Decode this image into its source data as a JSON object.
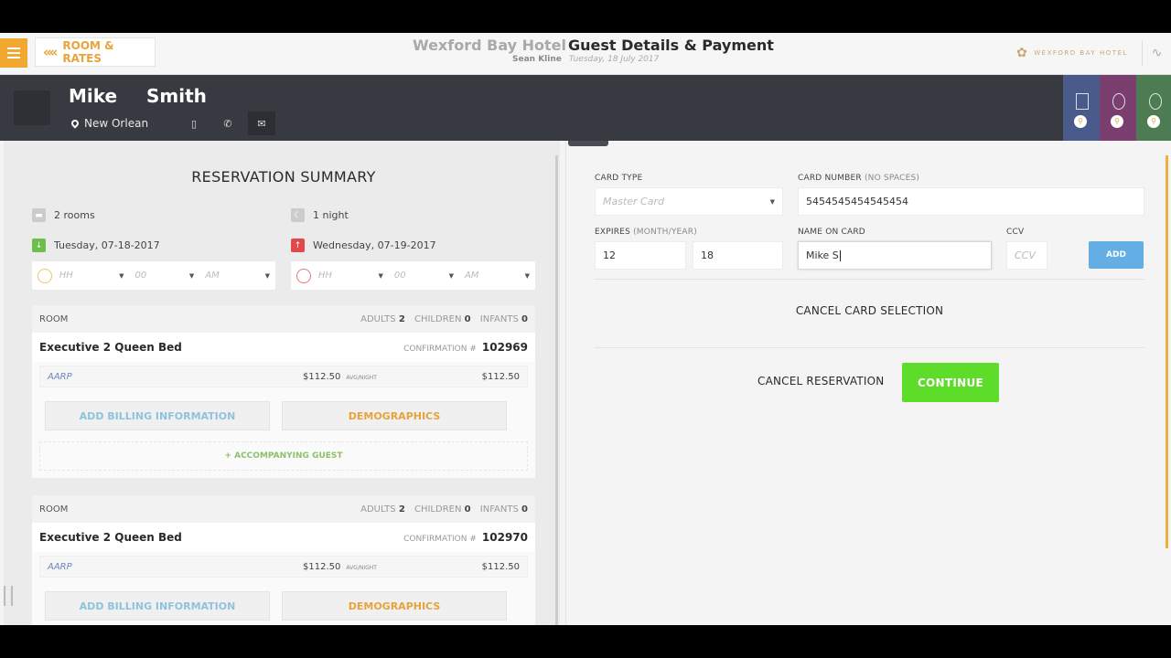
{
  "header": {
    "back_label": "ROOM & RATES",
    "hotel_name": "Wexford Bay Hotel",
    "page_title": "Guest Details & Payment",
    "agent_name": "Sean Kline",
    "date": "Tuesday, 18 July 2017",
    "brand_logo_text": "WEXFORD BAY HOTEL"
  },
  "guest": {
    "first_name": "Mike",
    "last_name": "Smith",
    "location": "New Orlean",
    "side_tab_colors": [
      "#4a5a8a",
      "#7a3f6f",
      "#4e7c52",
      "#3a7a58"
    ]
  },
  "summary": {
    "title": "RESERVATION SUMMARY",
    "rooms": "2 rooms",
    "nights": "1 night",
    "checkin": "Tuesday, 07-18-2017",
    "checkout": "Wednesday, 07-19-2017",
    "time_placeholders": {
      "hour": "HH",
      "minute": "00",
      "ampm": "AM"
    }
  },
  "room_cards": [
    {
      "room_label": "ROOM",
      "adults_label": "ADULTS",
      "adults": "2",
      "children_label": "CHILDREN",
      "children": "0",
      "infants_label": "INFANTS",
      "infants": "0",
      "room_type": "Executive 2 Queen Bed",
      "confirmation_label": "CONFIRMATION #",
      "confirmation": "102969",
      "rate_code": "AARP",
      "avg_night": "$112.50",
      "avg_night_label": "AVG/NIGHT",
      "total": "$112.50",
      "billing_label": "ADD BILLING INFORMATION",
      "demographics_label": "DEMOGRAPHICS",
      "accompanying_label": "+ ACCOMPANYING GUEST"
    },
    {
      "room_label": "ROOM",
      "adults_label": "ADULTS",
      "adults": "2",
      "children_label": "CHILDREN",
      "children": "0",
      "infants_label": "INFANTS",
      "infants": "0",
      "room_type": "Executive 2 Queen Bed",
      "confirmation_label": "CONFIRMATION #",
      "confirmation": "102970",
      "rate_code": "AARP",
      "avg_night": "$112.50",
      "avg_night_label": "AVG/NIGHT",
      "total": "$112.50",
      "billing_label": "ADD BILLING INFORMATION",
      "demographics_label": "DEMOGRAPHICS"
    }
  ],
  "payment": {
    "card_type_label": "CARD TYPE",
    "card_type_value": "Master Card",
    "card_number_label": "CARD NUMBER",
    "card_number_hint": "(NO SPACES)",
    "card_number_value": "5454545454545454",
    "expires_label": "EXPIRES",
    "expires_hint": "(MONTH/YEAR)",
    "exp_month": "12",
    "exp_year": "18",
    "name_label": "NAME ON CARD",
    "name_value": "Mike S",
    "ccv_label": "CCV",
    "ccv_placeholder": "CCV",
    "add_label": "ADD",
    "cancel_card_label": "CANCEL CARD SELECTION",
    "cancel_reservation_label": "CANCEL RESERVATION",
    "continue_label": "CONTINUE"
  },
  "colors": {
    "accent": "#e8a33a",
    "continue": "#5ddc2a",
    "add": "#63aee4",
    "guest_bar": "#373a40"
  }
}
